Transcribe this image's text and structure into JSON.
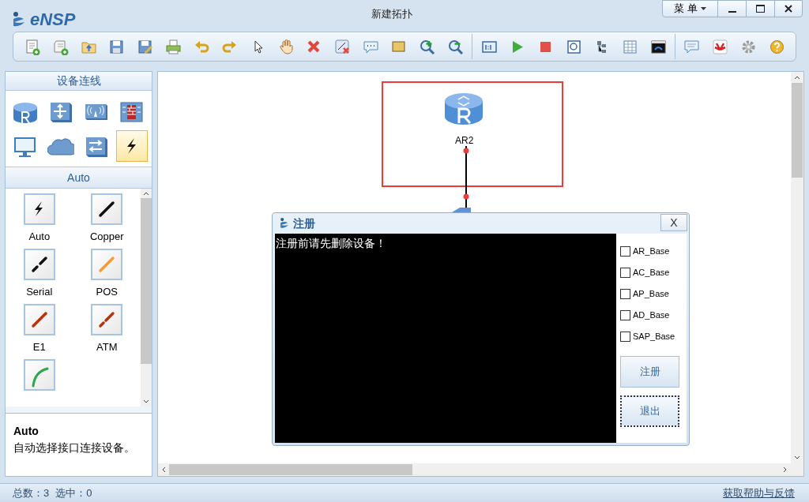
{
  "window": {
    "logo": "eNSP",
    "title": "新建拓扑",
    "menu": "菜 单"
  },
  "sidebar": {
    "title": "设备连线",
    "device_categories": [
      {
        "kind": "router",
        "selected": false
      },
      {
        "kind": "switch",
        "selected": false
      },
      {
        "kind": "wireless",
        "selected": false
      },
      {
        "kind": "firewall",
        "selected": false
      },
      {
        "kind": "pc",
        "selected": false
      },
      {
        "kind": "cloud",
        "selected": false
      },
      {
        "kind": "hub",
        "selected": false
      },
      {
        "kind": "link",
        "selected": true
      }
    ],
    "subtitle": "Auto",
    "links": [
      {
        "kind": "auto",
        "label": "Auto"
      },
      {
        "kind": "copper",
        "label": "Copper"
      },
      {
        "kind": "serial",
        "label": "Serial"
      },
      {
        "kind": "pos",
        "label": "POS"
      },
      {
        "kind": "e1",
        "label": "E1"
      },
      {
        "kind": "atm",
        "label": "ATM"
      },
      {
        "kind": "curve"
      }
    ],
    "description": {
      "title": "Auto",
      "text": "自动选择接口连接设备。"
    }
  },
  "canvas": {
    "device_label": "AR2"
  },
  "dialog": {
    "title": "注册",
    "close": "X",
    "console": "注册前请先删除设备！",
    "options": [
      {
        "label": "AR_Base",
        "checked": false
      },
      {
        "label": "AC_Base",
        "checked": false
      },
      {
        "label": "AP_Base",
        "checked": false
      },
      {
        "label": "AD_Base",
        "checked": false
      },
      {
        "label": "SAP_Base",
        "checked": false
      }
    ],
    "buttons": [
      {
        "label": "注册",
        "focused": false
      },
      {
        "label": "退出",
        "focused": true
      }
    ]
  },
  "status_bar": {
    "total": "总数：3",
    "selected": "选中：0",
    "link": "获取帮助与反馈"
  }
}
